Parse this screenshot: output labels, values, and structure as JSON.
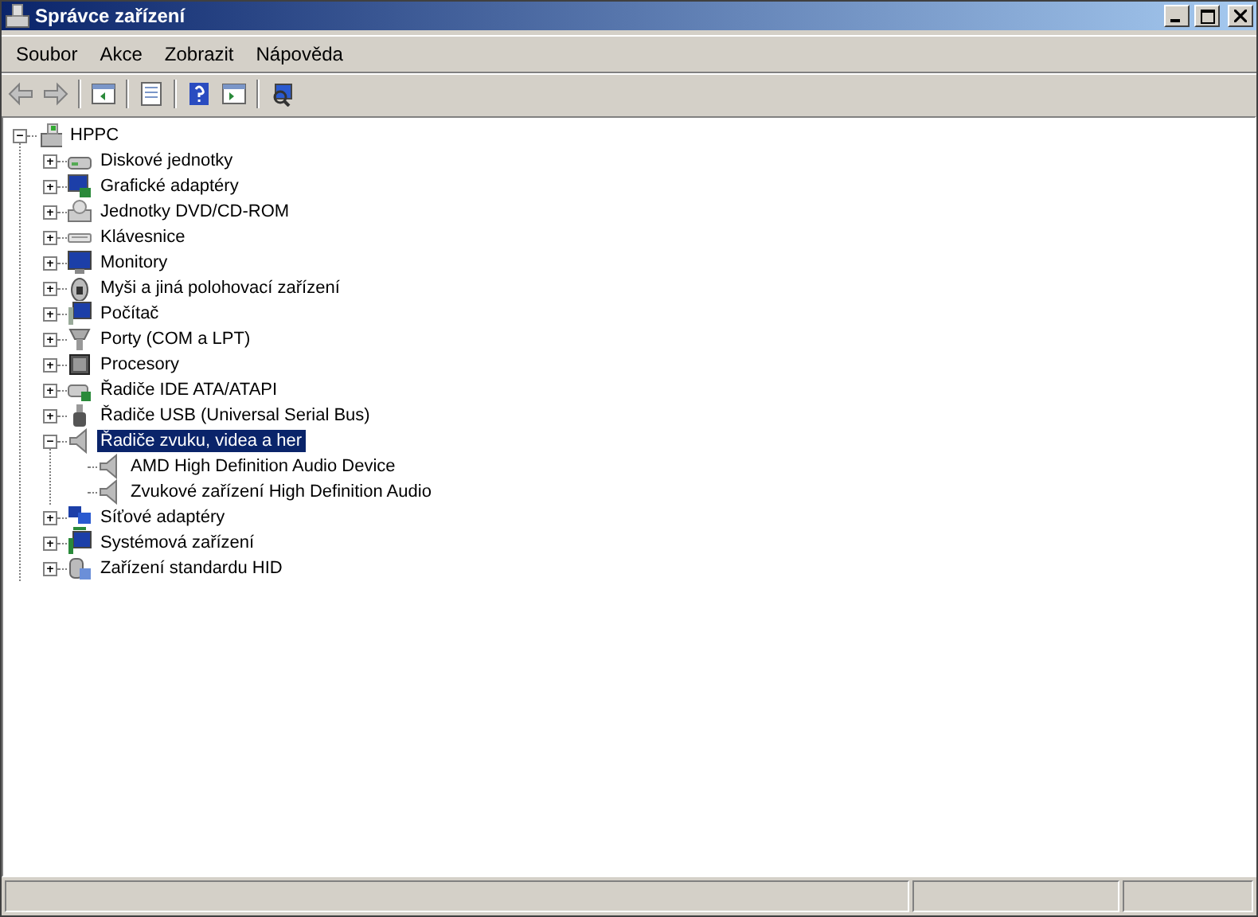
{
  "window": {
    "title": "Správce zařízení"
  },
  "menu": [
    "Soubor",
    "Akce",
    "Zobrazit",
    "Nápověda"
  ],
  "tree": {
    "label": "HPPC",
    "expanded": true,
    "selected": false,
    "children": [
      {
        "label": "Diskové jednotky",
        "expanded": false,
        "selected": false
      },
      {
        "label": "Grafické adaptéry",
        "expanded": false,
        "selected": false
      },
      {
        "label": "Jednotky DVD/CD-ROM",
        "expanded": false,
        "selected": false
      },
      {
        "label": "Klávesnice",
        "expanded": false,
        "selected": false
      },
      {
        "label": "Monitory",
        "expanded": false,
        "selected": false
      },
      {
        "label": "Myši a jiná polohovací zařízení",
        "expanded": false,
        "selected": false
      },
      {
        "label": "Počítač",
        "expanded": false,
        "selected": false
      },
      {
        "label": "Porty (COM a LPT)",
        "expanded": false,
        "selected": false
      },
      {
        "label": "Procesory",
        "expanded": false,
        "selected": false
      },
      {
        "label": "Řadiče IDE ATA/ATAPI",
        "expanded": false,
        "selected": false
      },
      {
        "label": "Řadiče USB (Universal Serial Bus)",
        "expanded": false,
        "selected": false
      },
      {
        "label": "Řadiče zvuku, videa a her",
        "expanded": true,
        "selected": true,
        "children": [
          {
            "label": "AMD High Definition Audio Device",
            "selected": false
          },
          {
            "label": "Zvukové zařízení High Definition Audio",
            "selected": false
          }
        ]
      },
      {
        "label": "Síťové adaptéry",
        "expanded": false,
        "selected": false
      },
      {
        "label": "Systémová zařízení",
        "expanded": false,
        "selected": false
      },
      {
        "label": "Zařízení standardu HID",
        "expanded": false,
        "selected": false
      }
    ]
  }
}
